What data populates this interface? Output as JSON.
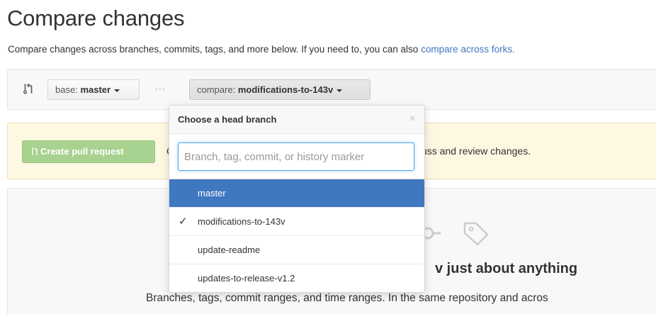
{
  "page": {
    "title": "Compare changes",
    "subtitle_text": "Compare changes across branches, commits, tags, and more below. If you need to, you can also",
    "subtitle_link": "compare across forks."
  },
  "range": {
    "base_prefix": "base:",
    "base_branch": "master",
    "separator": "···",
    "compare_prefix": "compare:",
    "compare_branch": "modifications-to-143v"
  },
  "notice": {
    "create_button": "Create pull request",
    "text_fragment_left": "C",
    "text_fragment_right": "uss and review changes."
  },
  "blank_slate": {
    "heading_fragment": "v just about anything",
    "description": "Branches, tags, commit ranges, and time ranges. In the same repository and acros"
  },
  "dropdown": {
    "title": "Choose a head branch",
    "close_symbol": "×",
    "filter_placeholder": "Branch, tag, commit, or history marker",
    "items": [
      {
        "label": "master",
        "highlighted": true,
        "selected": false
      },
      {
        "label": "modifications-to-143v",
        "highlighted": false,
        "selected": true
      },
      {
        "label": "update-readme",
        "highlighted": false,
        "selected": false
      },
      {
        "label": "updates-to-release-v1.2",
        "highlighted": false,
        "selected": false
      }
    ],
    "check_symbol": "✓"
  },
  "colors": {
    "link": "#4078c0",
    "highlight": "#4078c0",
    "create_button": "#a8d28f",
    "notice_bg": "#fdf8e1"
  },
  "icons": [
    "git-compare-icon",
    "create-pr-icon",
    "commit-icon",
    "tag-icon",
    "check-icon",
    "close-icon",
    "caret-down-icon"
  ]
}
